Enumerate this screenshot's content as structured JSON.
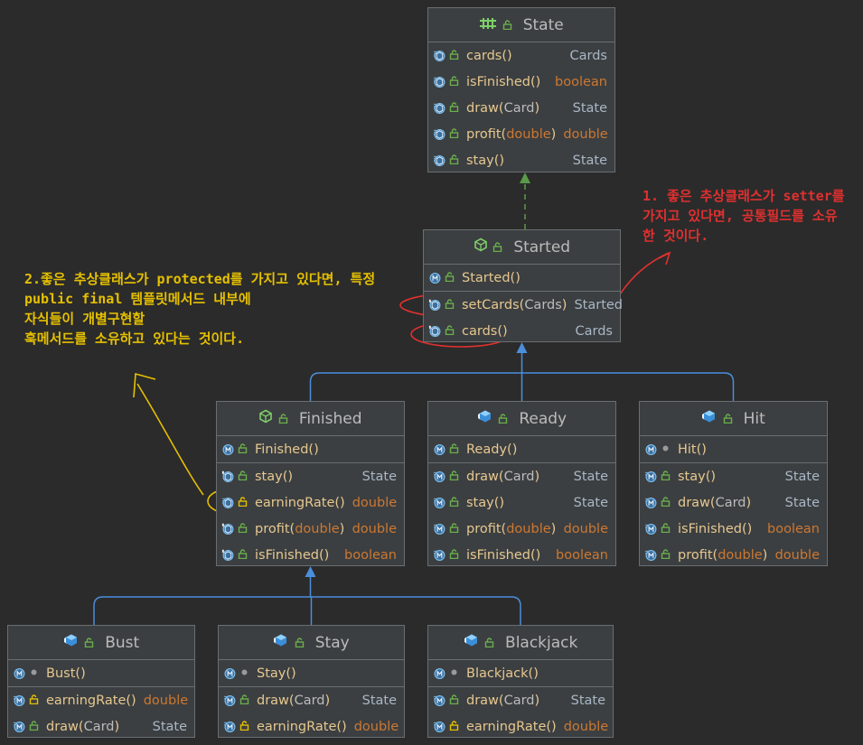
{
  "colors": {
    "background": "#2b2b2b",
    "node_fill": "#3c3f41",
    "method_name": "#e6c890",
    "primitive_type": "#cc7832",
    "class_type": "#a9b7c6",
    "inheritance_edge": "#4a8edc",
    "implements_edge": "#5a9a4a",
    "annotation_red": "#e03030",
    "annotation_yellow": "#e5c000"
  },
  "nodes": [
    {
      "id": "state",
      "name": "State",
      "kind": "interface",
      "members": [
        {
          "name": "cards",
          "params": "",
          "ret": "Cards",
          "icon": "abstract",
          "vis": "public"
        },
        {
          "name": "isFinished",
          "params": "",
          "ret": "boolean",
          "icon": "abstract",
          "vis": "public"
        },
        {
          "name": "draw",
          "params": "Card",
          "ret": "State",
          "icon": "abstract",
          "vis": "public"
        },
        {
          "name": "profit",
          "params": "double",
          "ret": "double",
          "icon": "abstract",
          "vis": "public"
        },
        {
          "name": "stay",
          "params": "",
          "ret": "State",
          "icon": "abstract",
          "vis": "public"
        }
      ]
    },
    {
      "id": "started",
      "name": "Started",
      "kind": "abstract",
      "members": [
        {
          "name": "Started",
          "params": "",
          "ret": "",
          "icon": "method",
          "vis": "public",
          "ctor": true
        },
        {
          "name": "setCards",
          "params": "Cards",
          "ret": "Started",
          "icon": "abstract-method",
          "vis": "public"
        },
        {
          "name": "cards",
          "params": "",
          "ret": "Cards",
          "icon": "abstract-method",
          "vis": "public"
        }
      ]
    },
    {
      "id": "finished",
      "name": "Finished",
      "kind": "abstract",
      "members": [
        {
          "name": "Finished",
          "params": "",
          "ret": "",
          "icon": "method",
          "vis": "public",
          "ctor": true
        },
        {
          "name": "stay",
          "params": "",
          "ret": "State",
          "icon": "abstract-method",
          "vis": "public"
        },
        {
          "name": "earningRate",
          "params": "",
          "ret": "double",
          "icon": "abstract",
          "vis": "protected"
        },
        {
          "name": "profit",
          "params": "double",
          "ret": "double",
          "icon": "abstract-method",
          "vis": "public"
        },
        {
          "name": "isFinished",
          "params": "",
          "ret": "boolean",
          "icon": "abstract-method",
          "vis": "public"
        }
      ]
    },
    {
      "id": "ready",
      "name": "Ready",
      "kind": "final",
      "members": [
        {
          "name": "Ready",
          "params": "",
          "ret": "",
          "icon": "method",
          "vis": "public",
          "ctor": true
        },
        {
          "name": "draw",
          "params": "Card",
          "ret": "State",
          "icon": "method-impl",
          "vis": "public"
        },
        {
          "name": "stay",
          "params": "",
          "ret": "State",
          "icon": "method-impl",
          "vis": "public"
        },
        {
          "name": "profit",
          "params": "double",
          "ret": "double",
          "icon": "method-impl",
          "vis": "public"
        },
        {
          "name": "isFinished",
          "params": "",
          "ret": "boolean",
          "icon": "method-impl",
          "vis": "public"
        }
      ]
    },
    {
      "id": "hit",
      "name": "Hit",
      "kind": "final",
      "members": [
        {
          "name": "Hit",
          "params": "",
          "ret": "",
          "icon": "method",
          "vis": "package",
          "ctor": true
        },
        {
          "name": "stay",
          "params": "",
          "ret": "State",
          "icon": "method-impl",
          "vis": "public"
        },
        {
          "name": "draw",
          "params": "Card",
          "ret": "State",
          "icon": "method-impl",
          "vis": "public"
        },
        {
          "name": "isFinished",
          "params": "",
          "ret": "boolean",
          "icon": "method-impl",
          "vis": "public"
        },
        {
          "name": "profit",
          "params": "double",
          "ret": "double",
          "icon": "method-impl",
          "vis": "public"
        }
      ]
    },
    {
      "id": "bust",
      "name": "Bust",
      "kind": "final",
      "members": [
        {
          "name": "Bust",
          "params": "",
          "ret": "",
          "icon": "method",
          "vis": "package",
          "ctor": true
        },
        {
          "name": "earningRate",
          "params": "",
          "ret": "double",
          "icon": "method-impl",
          "vis": "protected"
        },
        {
          "name": "draw",
          "params": "Card",
          "ret": "State",
          "icon": "method-impl",
          "vis": "public"
        }
      ]
    },
    {
      "id": "stay",
      "name": "Stay",
      "kind": "final",
      "members": [
        {
          "name": "Stay",
          "params": "",
          "ret": "",
          "icon": "method",
          "vis": "package",
          "ctor": true
        },
        {
          "name": "draw",
          "params": "Card",
          "ret": "State",
          "icon": "method-impl",
          "vis": "public"
        },
        {
          "name": "earningRate",
          "params": "",
          "ret": "double",
          "icon": "method-impl",
          "vis": "protected"
        }
      ]
    },
    {
      "id": "blackjack",
      "name": "Blackjack",
      "kind": "final",
      "members": [
        {
          "name": "Blackjack",
          "params": "",
          "ret": "",
          "icon": "method",
          "vis": "package",
          "ctor": true
        },
        {
          "name": "draw",
          "params": "Card",
          "ret": "State",
          "icon": "method-impl",
          "vis": "public"
        },
        {
          "name": "earningRate",
          "params": "",
          "ret": "double",
          "icon": "method-impl",
          "vis": "protected"
        }
      ]
    }
  ],
  "edges": [
    {
      "from": "started",
      "to": "state",
      "kind": "implements"
    },
    {
      "from": "finished",
      "to": "started",
      "kind": "extends"
    },
    {
      "from": "ready",
      "to": "started",
      "kind": "extends"
    },
    {
      "from": "hit",
      "to": "started",
      "kind": "extends"
    },
    {
      "from": "bust",
      "to": "finished",
      "kind": "extends"
    },
    {
      "from": "stay",
      "to": "finished",
      "kind": "extends"
    },
    {
      "from": "blackjack",
      "to": "finished",
      "kind": "extends"
    }
  ],
  "annotations": {
    "red_note": "1. 좋은 추상클래스가 setter를\n가지고 있다면, 공통필드를 소유\n한 것이다.",
    "yellow_note": "2.좋은 추상클래스가 protected를 가지고 있다면, 특정\npublic final 템플릿메서드 내부에\n자식들이 개별구현할\n훅메서드를 소유하고 있다는 것이다."
  }
}
